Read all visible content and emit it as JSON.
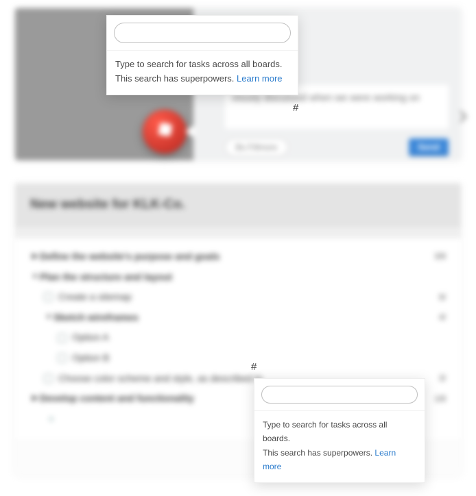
{
  "search_popover": {
    "hint_line1": "Type to search for tasks across all boards.",
    "hint_line2": "This search has superpowers.",
    "learn_more": "Learn more",
    "input_value": ""
  },
  "comment_card": {
    "message_text": "viously discussed when we were working on",
    "hash": "#",
    "attach_label": "Bo Fillmore",
    "send_label": "Send"
  },
  "project": {
    "title": "New website for KLK-Co.",
    "rows": [
      {
        "indent": 0,
        "caret": "right",
        "bold": true,
        "check": false,
        "text": "Define the website's purpose and goals",
        "badge": "3/8"
      },
      {
        "indent": 0,
        "caret": "down",
        "bold": true,
        "check": false,
        "text": "Plan the structure and layout",
        "badge": ""
      },
      {
        "indent": 1,
        "caret": "",
        "bold": false,
        "check": true,
        "text": "Create a sitemap",
        "badge": "9/"
      },
      {
        "indent": 1,
        "caret": "down",
        "bold": true,
        "check": false,
        "text": "Sketch wireframes",
        "badge": "4/"
      },
      {
        "indent": 2,
        "caret": "",
        "bold": false,
        "check": true,
        "text": "Option A",
        "badge": ""
      },
      {
        "indent": 2,
        "caret": "",
        "bold": false,
        "check": true,
        "text": "Option B",
        "badge": ""
      },
      {
        "indent": 1,
        "caret": "",
        "bold": false,
        "check": true,
        "text": "Choose color scheme and style, as described in",
        "badge": "3/"
      },
      {
        "indent": 0,
        "caret": "right",
        "bold": true,
        "check": false,
        "text": "Develop content and functionality",
        "badge": "1/8"
      }
    ],
    "list_hash": "#"
  }
}
